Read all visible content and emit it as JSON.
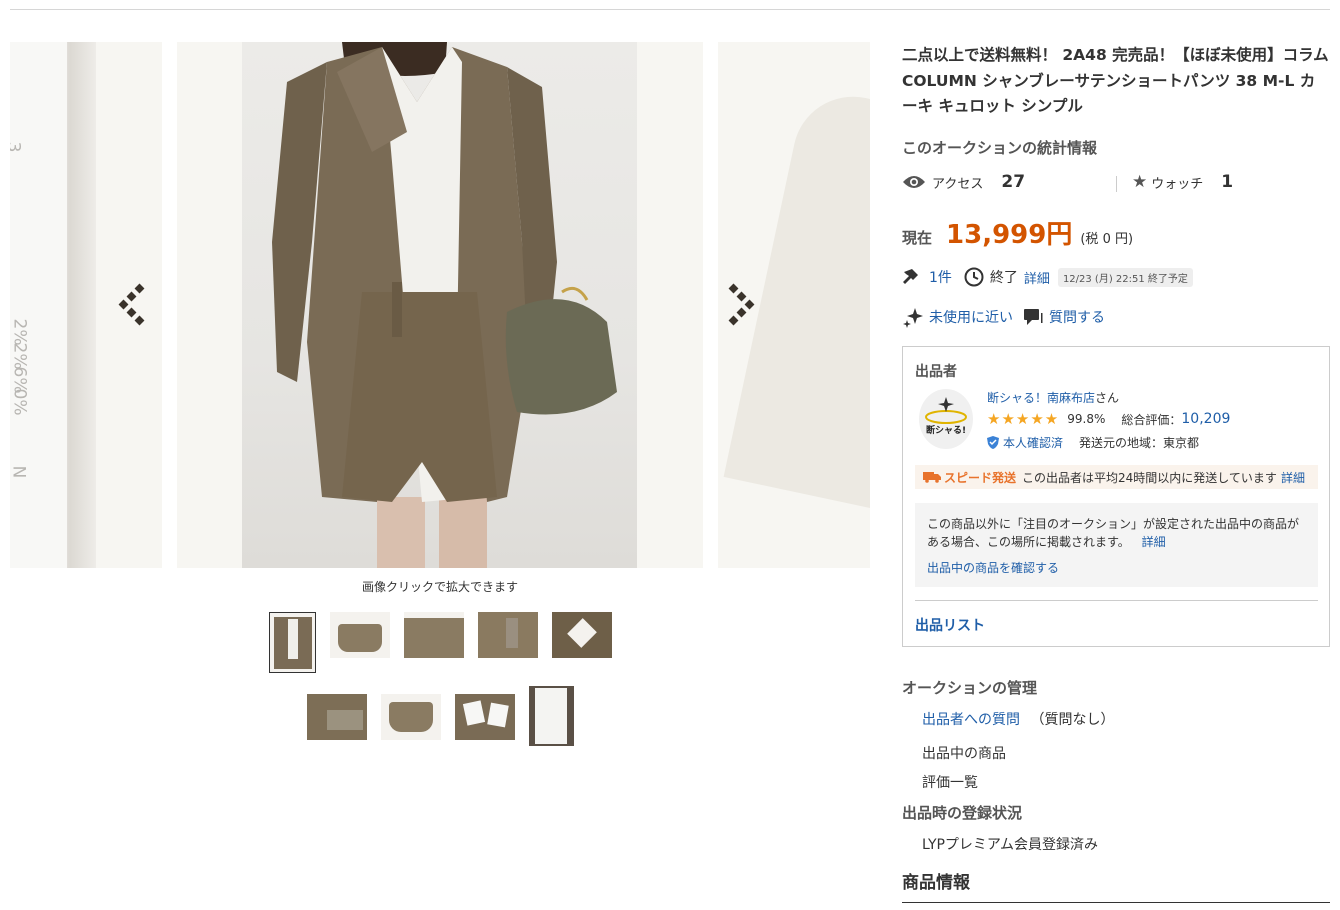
{
  "title": "二点以上で送料無料！ 2A48 完売品！【ほぼ未使用】コラム COLUMN シャンブレーサテンショートパンツ 38 M-L カーキ キュロット シンプル",
  "gallery": {
    "caption": "画像クリックで拡大できます",
    "left_tag_lines": [
      "3",
      "2%",
      "2%",
      "6%",
      "0%",
      "N"
    ]
  },
  "stats": {
    "heading": "このオークションの統計情報",
    "access_label": "アクセス",
    "access_value": "27",
    "watch_label": "ウォッチ",
    "watch_value": "1"
  },
  "price": {
    "label": "現在",
    "value": "13,999円",
    "tax": "(税 0 円)"
  },
  "bids": {
    "count": "1件",
    "end_label": "終了",
    "detail_link": "詳細",
    "end_time": "12/23 (月) 22:51 終了予定"
  },
  "condition": {
    "label": "未使用に近い",
    "question_button": "質問する"
  },
  "seller": {
    "heading": "出品者",
    "name": "断シャる！南麻布店",
    "suffix": "さん",
    "rating_pct": "99.8%",
    "stars": 5,
    "total_label": "総合評価：",
    "total_value": "10,209",
    "verified": "本人確認済",
    "ship_from": "発送元の地域：東京都",
    "avatar_text": "断シャる!",
    "speed_label": "スピード発送",
    "speed_text": "この出品者は平均24時間以内に発送しています",
    "speed_detail": "詳細",
    "promo_text": "この商品以外に「注目のオークション」が設定された出品中の商品がある場合、この場所に掲載されます。",
    "promo_detail": "詳細",
    "promo_link": "出品中の商品を確認する",
    "listing_link": "出品リスト"
  },
  "management": {
    "heading": "オークションの管理",
    "question_link": "出品者への質問",
    "question_note": "（質問なし）",
    "listings_link": "出品中の商品",
    "ratings_link": "評価一覧"
  },
  "registration": {
    "heading": "出品時の登録状況",
    "status": "LYPプレミアム会員登録済み"
  },
  "product_info": {
    "heading": "商品情報"
  },
  "colors": {
    "accent_price": "#d35400",
    "link": "#1f5ea8",
    "star": "#f5a623"
  }
}
